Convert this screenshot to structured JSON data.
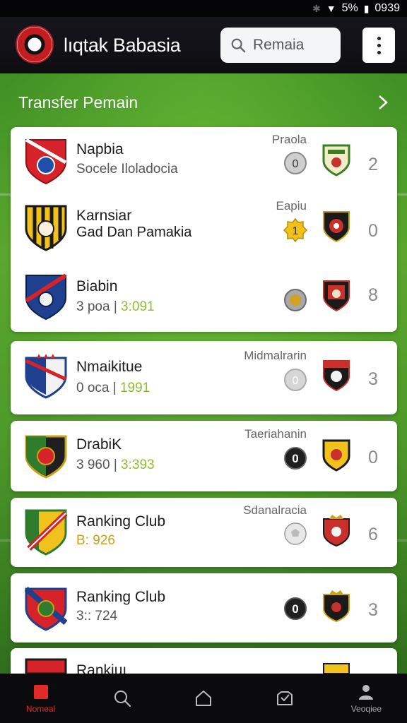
{
  "status_bar": {
    "time": "0939",
    "battery_text": "5%"
  },
  "app": {
    "title": "lıqtak Babasia"
  },
  "search": {
    "value": "Remaia",
    "placeholder": "Remaia"
  },
  "section": {
    "title": "Transfer Pemain"
  },
  "rows": [
    {
      "name": "Napbia",
      "subtitle": "Socele Iloladocia",
      "label": "Praola",
      "score": "2",
      "sub_style": "normal"
    },
    {
      "name": "Karnsiar",
      "subtitle": "Gad  Dan Pamakia",
      "label": "Eapiu",
      "score": "0",
      "sub_style": "normal"
    },
    {
      "name": "Biabin",
      "subtitle_prefix": "3 poa | ",
      "subtitle_highlight": "3:091",
      "label": "",
      "score": "8",
      "sub_style": "split"
    },
    {
      "name": "Nmaikitue",
      "subtitle_prefix": "0 oca | ",
      "subtitle_highlight": "1991",
      "label": "Midmalrarin",
      "score": "3",
      "sub_style": "split"
    },
    {
      "name": "DrabiK",
      "subtitle_prefix": "3 960 | ",
      "subtitle_highlight": "3:393",
      "label": "Taeriahanin",
      "score": "0",
      "sub_style": "split"
    },
    {
      "name": "Ranking Club",
      "subtitle": "B: 926",
      "label": "Sdanalracia",
      "score": "6",
      "sub_style": "gold"
    },
    {
      "name": "Ranking Club",
      "subtitle": "3:: 724",
      "label": "",
      "score": "3",
      "sub_style": "normal"
    },
    {
      "name": "Rankiuı",
      "subtitle": "",
      "label": "",
      "score": "",
      "sub_style": "normal"
    }
  ],
  "medals": [
    "0",
    "1",
    "0",
    "0",
    "0",
    "",
    "0",
    ""
  ],
  "nav": [
    {
      "label": "Nomeal",
      "icon": "home-square-icon",
      "active": true
    },
    {
      "label": "",
      "icon": "search-icon",
      "active": false
    },
    {
      "label": "",
      "icon": "house-icon",
      "active": false
    },
    {
      "label": "",
      "icon": "inbox-icon",
      "active": false
    },
    {
      "label": "Veoqiee",
      "icon": "profile-icon",
      "active": false
    }
  ],
  "colors": {
    "accent": "#e02a2a",
    "field_green": "#4e9a2a",
    "highlight": "#8bbf2a",
    "gold": "#c9a218"
  }
}
